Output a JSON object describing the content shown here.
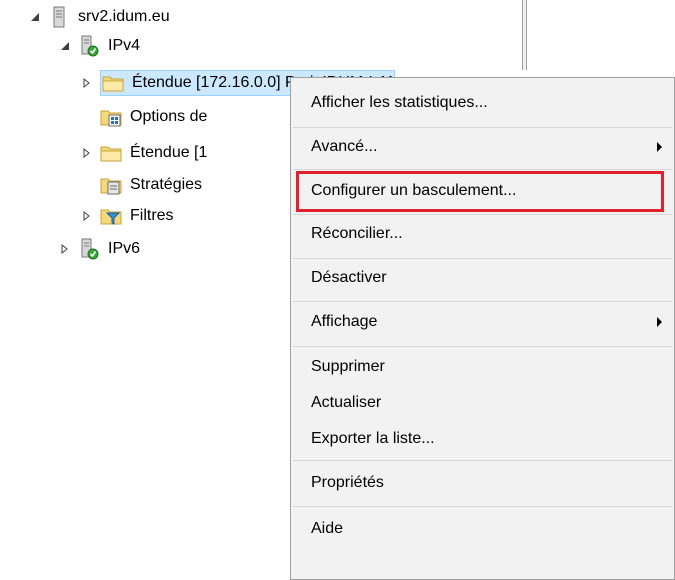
{
  "tree": {
    "server": "srv2.idum.eu",
    "ipv4": "IPv4",
    "etendue1": "Étendue [172.16.0.0] ProjeIDUM-LAN",
    "options": "Options de",
    "etendue2": "Étendue [1",
    "strategies": "Stratégies",
    "filtres": "Filtres",
    "ipv6": "IPv6"
  },
  "menu": {
    "stats": "Afficher les statistiques...",
    "avance": "Avancé...",
    "basculement": "Configurer un basculement...",
    "reconcilier": "Réconcilier...",
    "desactiver": "Désactiver",
    "affichage": "Affichage",
    "supprimer": "Supprimer",
    "actualiser": "Actualiser",
    "exporter": "Exporter la liste...",
    "proprietes": "Propriétés",
    "aide": "Aide"
  },
  "colors": {
    "selection": "#cce8ff",
    "highlight_box": "#e0202a",
    "menu_bg": "#f2f2f2"
  }
}
